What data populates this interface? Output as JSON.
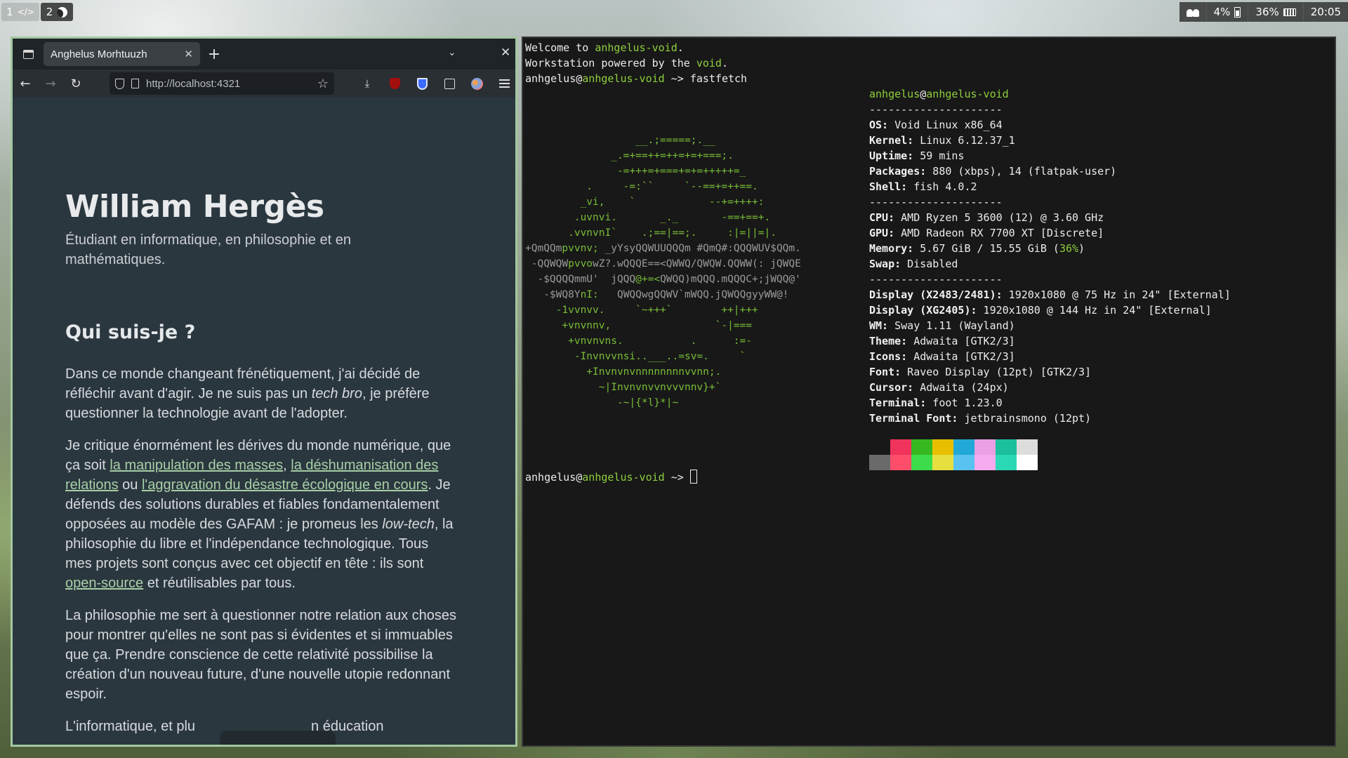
{
  "topbar": {
    "workspaces": [
      {
        "number": "1",
        "icon": "code-icon",
        "glyph": "</>"
      },
      {
        "number": "2",
        "icon": "moon-icon"
      }
    ],
    "status": {
      "battery": "4%",
      "memory": "36%",
      "clock": "20:05"
    }
  },
  "browser": {
    "tab_title": "Anghelus Morhtuuzh",
    "new_tab_label": "+",
    "url": "http://localhost:4321",
    "page": {
      "title": "William Hergès",
      "subtitle": "Étudiant en informatique, en philosophie et en mathématiques.",
      "section_heading": "Qui suis-je ?",
      "p1_a": "Dans ce monde changeant frénétiquement, j'ai décidé de réfléchir avant d'agir. Je ne suis pas un ",
      "p1_em": "tech bro",
      "p1_b": ", je préfère questionner la technologie avant de l'adopter.",
      "p2_a": "Je critique énormément les dérives du monde numérique, que ça soit ",
      "p2_link1": "la manipulation des masses",
      "p2_sep1": ", ",
      "p2_link2": "la déshumanisation des relations",
      "p2_sep2": " ou ",
      "p2_link3": "l'aggravation du désastre écologique en cours",
      "p2_b": ". Je défends des solutions durables et fiables fondamentalement opposées au modèle des GAFAM : je promeus les ",
      "p2_em": "low-tech",
      "p2_c": ", la philosophie du libre et l'indépendance technologique. Tous mes projets sont conçus avec cet objectif en tête : ils sont ",
      "p2_link4": "open-source",
      "p2_d": " et réutilisables par tous.",
      "p3": "La philosophie me sert à questionner notre relation aux choses pour montrer qu'elles ne sont pas si évidentes et si immuables que ça. Prendre conscience de cette relativité possibilise la création d'un nouveau future, d'une nouvelle utopie redonnant espoir.",
      "p4_partial_a": "L'informatique, et plu",
      "p4_partial_b": "n éducation"
    }
  },
  "terminal": {
    "welcome_a": "Welcome to ",
    "welcome_host": "anhgelus-void",
    "welcome_b": ".",
    "powered_a": "Workstation powered by the ",
    "powered_word": "void",
    "powered_b": ".",
    "prompt_user": "anhgelus",
    "prompt_at": "@",
    "prompt_host": "anhgelus-void",
    "prompt_arrow": " ~> ",
    "command": "fastfetch",
    "info_user": "anhgelus",
    "info_at": "@",
    "info_host": "anhgelus-void",
    "separator": "---------------------",
    "info": [
      {
        "label": "OS",
        "value": " Void Linux x86_64"
      },
      {
        "label": "Kernel",
        "value": " Linux 6.12.37_1"
      },
      {
        "label": "Uptime",
        "value": " 59 mins"
      },
      {
        "label": "Packages",
        "value": " 880 (xbps), 14 (flatpak-user)"
      },
      {
        "label": "Shell",
        "value": " fish 4.0.2"
      }
    ],
    "hardware": [
      {
        "label": "CPU",
        "value": " AMD Ryzen 5 3600 (12) @ 3.60 GHz"
      },
      {
        "label": "GPU",
        "value": " AMD Radeon RX 7700 XT [Discrete]"
      }
    ],
    "memory_label": "Memory",
    "memory_value": " 5.67 GiB / 15.55 GiB (",
    "memory_percent": "36%",
    "memory_close": ")",
    "swap_label": "Swap",
    "swap_value": " Disabled",
    "display": [
      {
        "label": "Display (X2483/2481)",
        "value": " 1920x1080 @ 75 Hz in 24\" [External]"
      },
      {
        "label": "Display (XG2405)",
        "value": " 1920x1080 @ 144 Hz in 24\" [External]"
      },
      {
        "label": "WM",
        "value": " Sway 1.11 (Wayland)"
      },
      {
        "label": "Theme",
        "value": " Adwaita [GTK2/3]"
      },
      {
        "label": "Icons",
        "value": " Adwaita [GTK2/3]"
      },
      {
        "label": "Font",
        "value": " Raveo Display (12pt) [GTK2/3]"
      },
      {
        "label": "Cursor",
        "value": " Adwaita (24px)"
      },
      {
        "label": "Terminal",
        "value": " foot 1.23.0"
      },
      {
        "label": "Terminal Font",
        "value": " jetbrainsmono (12pt)"
      }
    ],
    "palette": [
      "#181818",
      "#f0335d",
      "#37b820",
      "#e8bf00",
      "#22a8d6",
      "#e9a0e4",
      "#1bbf9c",
      "#dcdcdc",
      "#6a6a6a",
      "#ff4d6a",
      "#3ddc4b",
      "#e5e040",
      "#5ac2f0",
      "#f5aaf0",
      "#2ad8b6",
      "#ffffff"
    ],
    "logo": [
      {
        "l": "                  __.;=====;.__"
      },
      {
        "l": "              _.=+==++=++=+=+===;."
      },
      {
        "l": "               -=+++=+===+=+=+++++=_"
      },
      {
        "l": "          .     -=:``     `--==+=++==."
      },
      {
        "l": "         _vi,    `            --+=++++:"
      },
      {
        "l": "        .uvnvi.       _._       -==+==+."
      },
      {
        "l": "       .vvnvnI`    .;==|==;.     :|=||=|."
      },
      {
        "d": "+QmQQm",
        "l": "pvvnv;",
        "d2": " _yYsyQQWUUQQQm #QmQ#:QQQWUV$QQm."
      },
      {
        "d": " -QQWQW",
        "l": "pvvo",
        "d2": "wZ?.wQQQE==<QWWQ/QWQW.QQWW(: jQWQE"
      },
      {
        "d": "  -$QQQQmmU'  jQQQ",
        "l": "@+=<",
        "d2": "QWQQ)mQQQ.mQQQC+;jWQQ@'"
      },
      {
        "d": "   -$WQ8Y",
        "l": "nI:",
        "d2": "   QWQQwgQQWV`mWQQ.jQWQQgyyWW@!"
      },
      {
        "l": "     -1vvnvv.     `~+++`        ++|+++"
      },
      {
        "l": "      +vnvnnv,                 `-|==="
      },
      {
        "l": "       +vnvnvns.           .      :=-"
      },
      {
        "l": "        -Invnvvnsi..___..=sv=.     `"
      },
      {
        "l": "          +Invnvnvnnnnnnnnvvnn;."
      },
      {
        "l": "            ~|Invnvnvvnvvvnnv}+`"
      },
      {
        "l": "               -~|{*l}*|~"
      }
    ]
  }
}
